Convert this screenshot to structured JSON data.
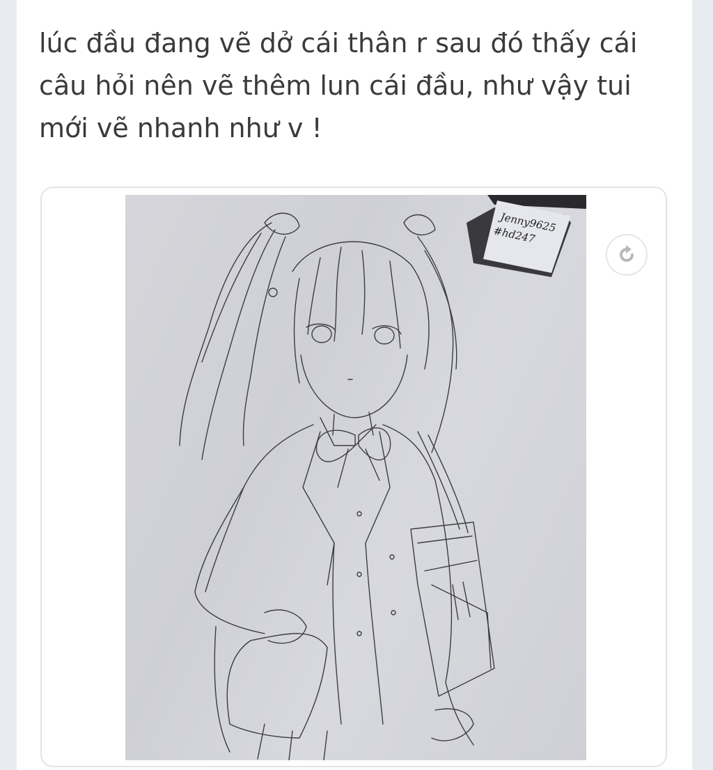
{
  "post": {
    "body_text": "lúc đầu đang vẽ dở cái thân r sau đó thấy cái câu hỏi nên vẽ thêm lun cái đầu, như vậy tui mới vẽ nhanh như v !"
  },
  "attachment": {
    "sticky_note_line1": "Jenny9625",
    "sticky_note_line2": "#hd247",
    "rotate_icon": "rotate-icon"
  },
  "colors": {
    "text": "#3a3a3a",
    "page_bg": "#e8ecf0",
    "card_bg": "#ffffff",
    "border": "#e1e4e8"
  }
}
